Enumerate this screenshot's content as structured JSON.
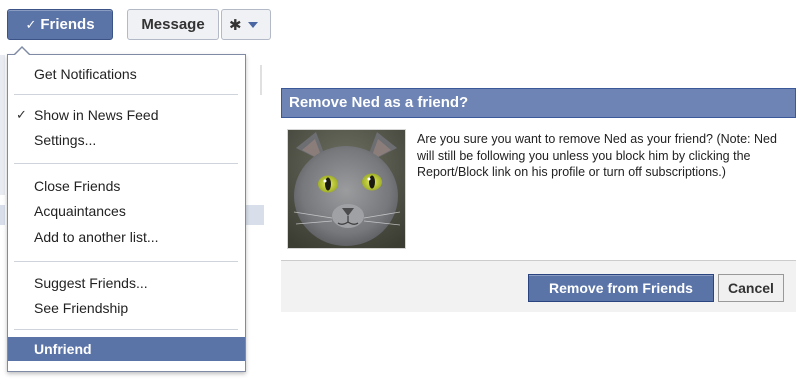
{
  "toolbar": {
    "friends_label": "Friends",
    "message_label": "Message",
    "check_icon": "check-icon",
    "gear_icon": "gear-icon"
  },
  "menu": {
    "items": [
      {
        "label": "Get Notifications",
        "checked": false
      },
      {
        "label": "Show in News Feed",
        "checked": true
      },
      {
        "label": "Settings...",
        "checked": false
      },
      {
        "label": "Close Friends",
        "checked": false
      },
      {
        "label": "Acquaintances",
        "checked": false
      },
      {
        "label": "Add to another list...",
        "checked": false
      },
      {
        "label": "Suggest Friends...",
        "checked": false
      },
      {
        "label": "See Friendship",
        "checked": false
      },
      {
        "label": "Unfriend",
        "checked": false,
        "highlighted": true
      }
    ]
  },
  "dialog": {
    "title": "Remove Ned as a friend?",
    "message": "Are you sure you want to remove Ned as your friend? (Note: Ned will still be following you unless you block him by clicking the Report/Block link on his profile or turn off subscriptions.)",
    "confirm_label": "Remove from Friends",
    "cancel_label": "Cancel"
  },
  "colors": {
    "brand_blue": "#5b74a8",
    "dialog_header": "#6d84b4"
  }
}
